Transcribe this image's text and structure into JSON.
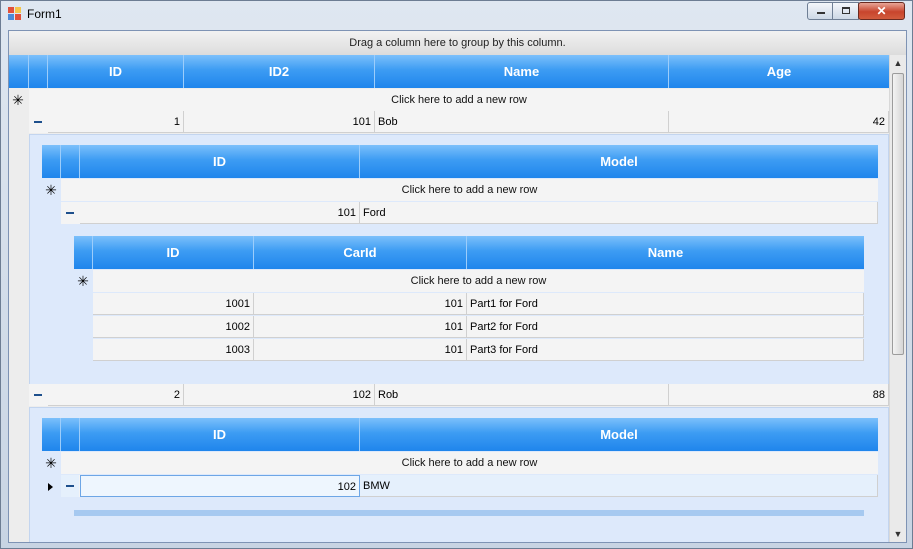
{
  "window": {
    "title": "Form1",
    "min_glyph": "",
    "max_glyph": "",
    "close_glyph": "✕"
  },
  "groupbar": {
    "text": "Drag a column here to group by this column."
  },
  "new_row_text": "Click here to add a new row",
  "new_row_glyph": "✳",
  "top": {
    "headers": [
      "ID",
      "ID2",
      "Name",
      "Age"
    ],
    "rows": [
      {
        "id": "1",
        "id2": "101",
        "name": "Bob",
        "age": "42"
      },
      {
        "id": "2",
        "id2": "102",
        "name": "Rob",
        "age": "88"
      }
    ]
  },
  "cars_1": {
    "headers": [
      "ID",
      "Model"
    ],
    "rows": [
      {
        "id": "101",
        "model": "Ford"
      }
    ]
  },
  "parts_1": {
    "headers": [
      "ID",
      "CarId",
      "Name"
    ],
    "rows": [
      {
        "id": "1001",
        "carid": "101",
        "name": "Part1 for Ford"
      },
      {
        "id": "1002",
        "carid": "101",
        "name": "Part2 for Ford"
      },
      {
        "id": "1003",
        "carid": "101",
        "name": "Part3 for Ford"
      }
    ]
  },
  "cars_2": {
    "headers": [
      "ID",
      "Model"
    ],
    "rows": [
      {
        "id": "102",
        "model": "BMW"
      }
    ]
  },
  "scrollbar": {
    "up_glyph": "▲",
    "down_glyph": "▼"
  },
  "colors": {
    "header_blue": "#3d9cf3",
    "detail_bg": "#dde9fb"
  }
}
